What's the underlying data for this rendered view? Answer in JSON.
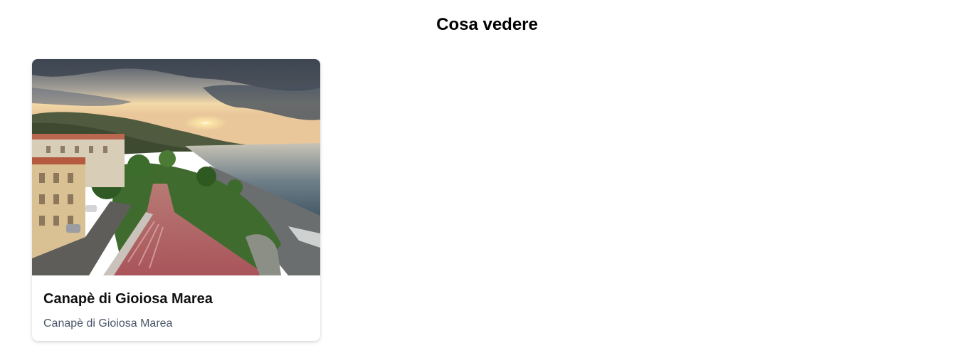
{
  "section": {
    "title": "Cosa vedere"
  },
  "cards": [
    {
      "title": "Canapè di Gioiosa Marea",
      "subtitle": "Canapè di Gioiosa Marea",
      "image_alt": "Canapè di Gioiosa Marea"
    }
  ],
  "colors": {
    "background": "#ffffff",
    "title": "#000000",
    "subtitle": "#4a5568"
  }
}
